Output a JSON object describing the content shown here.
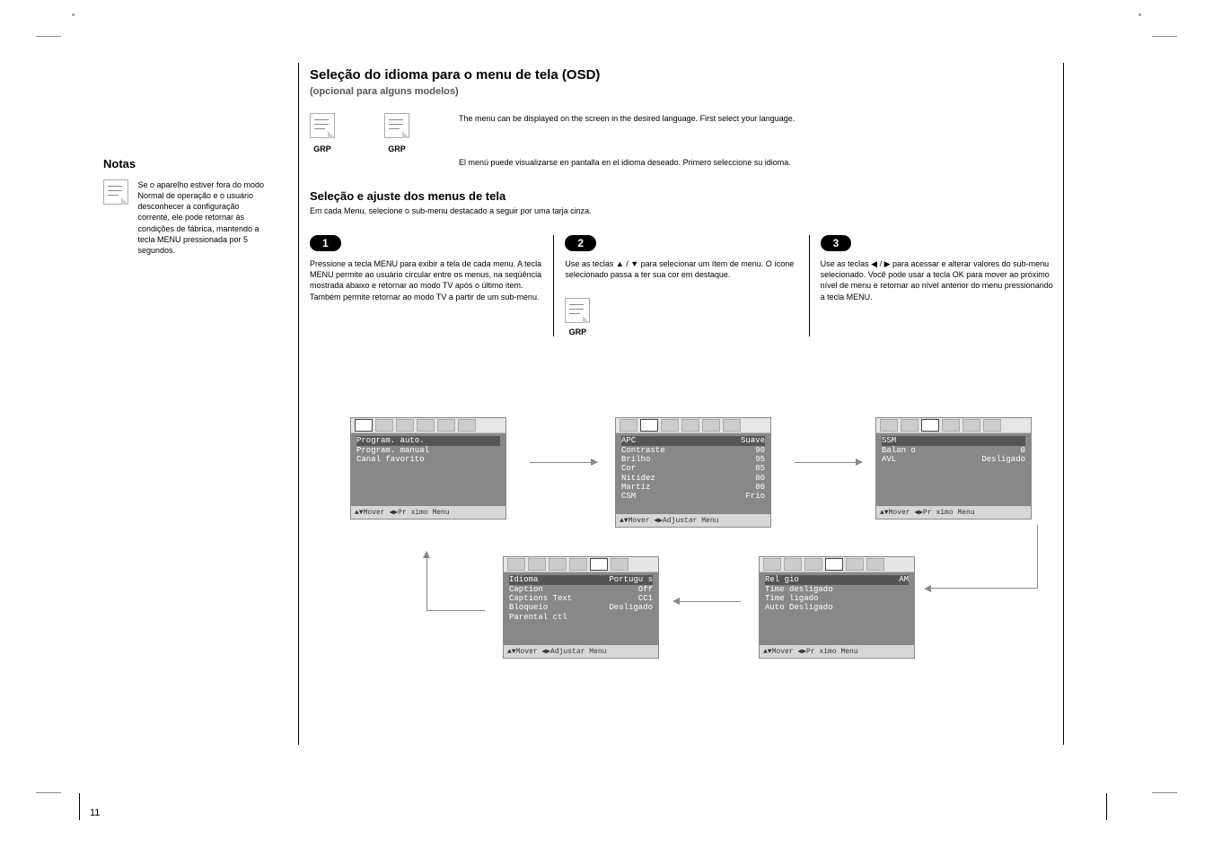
{
  "page_number": "11",
  "sidebar": {
    "title": "Notas",
    "reset_note": "Se o aparelho estiver fora do modo Normal de operação e o usuário desconhecer a configuração corrente, ele pode retornar às condições de fábrica, mantendo a tecla MENU pressionada por 5 segundos."
  },
  "header": {
    "title": "Seleção do idioma para o menu de tela (OSD)",
    "subtitle": "(opcional para alguns modelos)",
    "lang_row_1": "The menu can be displayed on the screen in the desired language. First select your language.",
    "lang_row_2": "El menú puede visualizarse en pantalla en el idioma deseado. Primero seleccione su idioma.",
    "note_grp_label": "GRP"
  },
  "selection": {
    "title": "Seleção e ajuste dos menus de tela",
    "subtitle": "Em cada Menu, selecione o sub-menu destacado a seguir por uma tarja cinza."
  },
  "steps": [
    {
      "n": "1",
      "body": "Pressione a tecla MENU para exibir a tela de cada menu. A tecla MENU permite ao usuário circular entre os menus, na seqüência mostrada abaixo e retornar ao modo TV após o último item. Também permite retornar ao modo TV a partir de um sub-menu."
    },
    {
      "n": "2",
      "body": "Use as teclas ▲ / ▼ para selecionar um ítem de menu. O ícone selecionado passa a ter sua cor em destaque."
    },
    {
      "n": "3",
      "body": "Use as teclas ◀ / ▶ para acessar e alterar valores do sub-menu selecionado. Você pode usar a tecla OK para mover ao próximo nível de menu e retornar ao nível anterior do menu pressionando a tecla MENU."
    }
  ],
  "osd": {
    "footer_move_next": "▲▼Mover  ◀▶Pr ximo Menu",
    "footer_move_adjust": "▲▼Mover  ◀▶Adjustar Menu",
    "canal": {
      "rows": [
        {
          "l": "Program. auto.",
          "r": ""
        },
        {
          "l": "Program. manual",
          "r": ""
        },
        {
          "l": "Canal favorito",
          "r": ""
        }
      ]
    },
    "imagem": {
      "rows": [
        {
          "l": "APC",
          "r": "Suave"
        },
        {
          "l": "Contraste",
          "r": "90"
        },
        {
          "l": "Brilho",
          "r": "95"
        },
        {
          "l": "Cor",
          "r": "85"
        },
        {
          "l": "Nitidez",
          "r": "80"
        },
        {
          "l": "Martiz",
          "r": "80"
        },
        {
          "l": "CSM",
          "r": "Frio"
        }
      ]
    },
    "som": {
      "rows": [
        {
          "l": "SSM",
          "r": ""
        },
        {
          "l": "Balan o",
          "r": "0"
        },
        {
          "l": "AVL",
          "r": "Desligado"
        }
      ]
    },
    "tempo": {
      "rows": [
        {
          "l": "Rel gio",
          "r": "AM"
        },
        {
          "l": "Time desligado",
          "r": ""
        },
        {
          "l": "Time ligado",
          "r": ""
        },
        {
          "l": "Auto Desligado",
          "r": ""
        }
      ]
    },
    "especial": {
      "rows": [
        {
          "l": "Idioma",
          "r": "Portugu s"
        },
        {
          "l": "Caption",
          "r": "Off"
        },
        {
          "l": "Captions Text",
          "r": "CC1"
        },
        {
          "l": "Bloqueio",
          "r": "Desligado"
        },
        {
          "l": "Parental ctl",
          "r": ""
        }
      ]
    }
  }
}
